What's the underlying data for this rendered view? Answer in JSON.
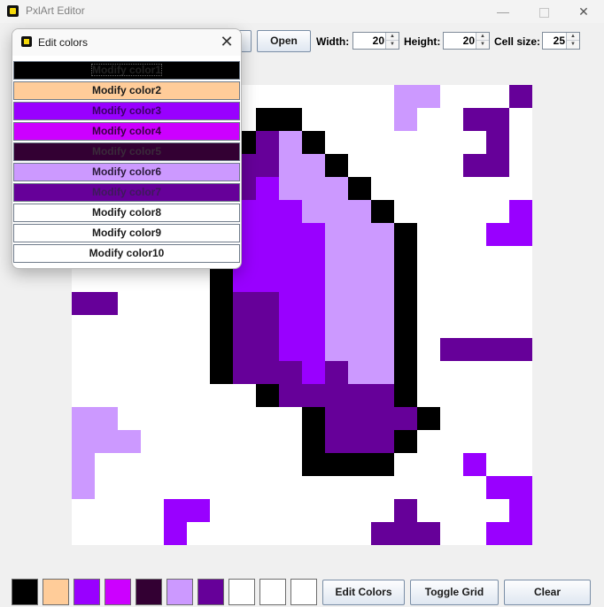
{
  "window": {
    "title": "PxlArt Editor"
  },
  "toolbar": {
    "open_label": "Open",
    "width_label": "Width:",
    "width_value": "20",
    "height_label": "Height:",
    "height_value": "20",
    "cellsize_label": "Cell size:",
    "cellsize_value": "25"
  },
  "dialog": {
    "title": "Edit colors",
    "buttons": [
      {
        "label": "Modify color1",
        "bg": "#000000",
        "fg": "#222222"
      },
      {
        "label": "Modify color2",
        "bg": "#ffcc99",
        "fg": "#1a1a1a"
      },
      {
        "label": "Modify color3",
        "bg": "#9900ff",
        "fg": "#3a0066"
      },
      {
        "label": "Modify color4",
        "bg": "#cc00ff",
        "fg": "#3a0044"
      },
      {
        "label": "Modify color5",
        "bg": "#330033",
        "fg": "#3a2a3a"
      },
      {
        "label": "Modify color6",
        "bg": "#cc99ff",
        "fg": "#2a1a3a"
      },
      {
        "label": "Modify color7",
        "bg": "#660099",
        "fg": "#3d1a5a"
      },
      {
        "label": "Modify color8",
        "bg": "#ffffff",
        "fg": "#1a1a1a"
      },
      {
        "label": "Modify color9",
        "bg": "#ffffff",
        "fg": "#1a1a1a"
      },
      {
        "label": "Modify color10",
        "bg": "#ffffff",
        "fg": "#1a1a1a"
      }
    ]
  },
  "palette": [
    "#000000",
    "#ffcc99",
    "#9900ff",
    "#cc00ff",
    "#330033",
    "#cc99ff",
    "#660099",
    "#ffffff",
    "#ffffff",
    "#ffffff"
  ],
  "bottom_buttons": {
    "edit_colors": "Edit Colors",
    "toggle_grid": "Toggle Grid",
    "clear": "Clear"
  },
  "pixel_grid": {
    "legend": {
      ".": "#ffffff",
      "K": "#000000",
      "V": "#9900ff",
      "L": "#cc99ff",
      "P": "#660099",
      "M": "#cc00ff",
      "D": "#330033",
      "S": "#ffcc99"
    },
    "rows": [
      "00000000000000LL000P",
      "00000000KK0000L00PP0",
      "0000000KPLK0000000P0",
      "000000KPPLLK00000PP0",
      "000000KPVLLLK0000000",
      "000000KVVVLLLK00000V",
      "000000KVVVVLLLK000VV",
      "000000KVVVVLLLK00000",
      "000000KVVVVLLLK00000",
      "PP0000KPPVVLLLK00000",
      "000000KPPVVLLLK00000",
      "000000KPPVVLLLK0PPPP",
      "000000KPPPVPLLK00000",
      "00000000KPPPPPK00000",
      "LL00000000KPPPPK0000",
      "LLL0000000KPPPK00000",
      "L000000000KKKK000V00",
      "L00000000000000000VVV",
      "0000VV00000000P0000V0",
      "0000V00000000PPP00VVV"
    ]
  }
}
